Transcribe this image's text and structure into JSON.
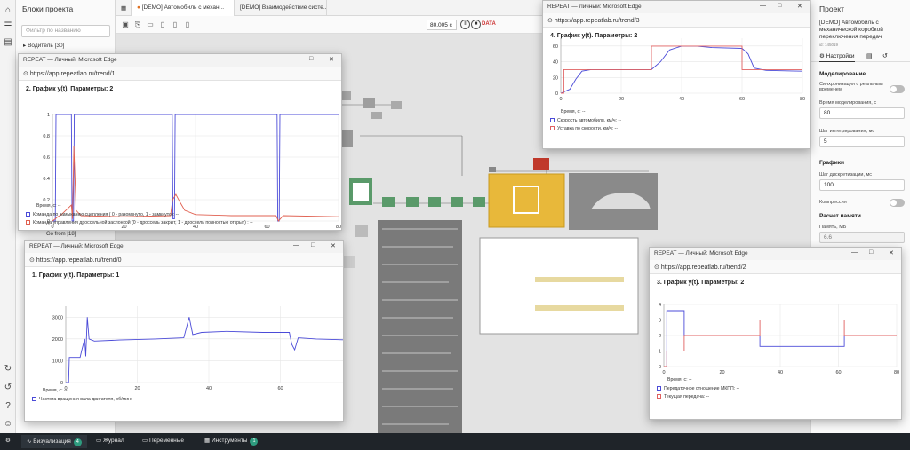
{
  "left_panel": {
    "title": "Блоки проекта",
    "search_placeholder": "Фильтр по названию",
    "group_label": "Водитель [30]",
    "goto_label": "Go from [18]"
  },
  "tabs": [
    {
      "label": "[DEMO] Автомобиль с механ..."
    },
    {
      "label": "[DEMO] Взаимодействие систе..."
    }
  ],
  "toolbar": {
    "sim_time": "80.005 с",
    "data_tag": "DATA"
  },
  "right_panel": {
    "header": "Проект",
    "project_name": "[DEMO] Автомобиль с механической коробкой переключения передач",
    "project_id": "id: 145019",
    "tab_settings": "Настройки",
    "section_modeling": "Моделирование",
    "sync_label": "Синхронизация с реальным временем",
    "model_time_label": "Время моделирования, с",
    "model_time_value": "80",
    "step_label": "Шаг интегрирования, мс",
    "step_value": "5",
    "section_graphs": "Графики",
    "discrete_label": "Шаг дискретизации, мс",
    "discrete_value": "100",
    "compression_label": "Компрессия",
    "section_memory": "Расчет памяти",
    "memory_label": "Память, МБ",
    "memory_value": "6.6"
  },
  "bottom_bar": {
    "visualization": "Визуализация",
    "visualization_badge": "4",
    "journal": "Журнал",
    "variables": "Переменные",
    "tools": "Инструменты",
    "tools_badge": "1"
  },
  "windows": [
    {
      "title": "REPEAT — Личный: Microsoft Edge",
      "url": "https://app.repeatlab.ru/trend/1",
      "graph_title": "2. График y(t). Параметры: 2",
      "time_label": "Время, с: --",
      "legend": [
        "Команда по замыканию сцепления ( 0 - разомкнуто, 1 - замкнуто): --",
        "Команда управления дроссельной заслонкой (0 - дроссель закрыт, 1 - дроссель полностью открыт) : --"
      ],
      "chart_data": {
        "type": "line",
        "xlim": [
          0,
          80
        ],
        "ylim": [
          0,
          1
        ],
        "xticks": [
          0,
          20,
          40,
          60,
          80
        ],
        "yticks": [
          0,
          0.2,
          0.4,
          0.6,
          0.8,
          1
        ],
        "series": [
          {
            "name": "Команда по замыканию сцепления ( 0 - разомкнуто, 1 - замкнуто)",
            "color": "#4b4bd8",
            "points": [
              [
                0,
                0
              ],
              [
                0.8,
                0
              ],
              [
                1,
                1
              ],
              [
                5.3,
                1
              ],
              [
                5.5,
                0
              ],
              [
                5.9,
                0
              ],
              [
                6.1,
                1
              ],
              [
                33.5,
                1
              ],
              [
                33.7,
                0.02
              ],
              [
                34.1,
                0.02
              ],
              [
                34.3,
                1
              ],
              [
                62.8,
                1
              ],
              [
                63,
                0
              ],
              [
                63.4,
                0
              ],
              [
                63.6,
                1
              ],
              [
                80,
                1
              ]
            ]
          },
          {
            "name": "Команда управления дроссельной заслонкой (0 - дроссель закрыт, 1 - дроссель полностью открыт)",
            "color": "#e06050",
            "points": [
              [
                0,
                0
              ],
              [
                0.8,
                0.02
              ],
              [
                1.5,
                0.04
              ],
              [
                2.5,
                0.06
              ],
              [
                5.3,
                0.15
              ],
              [
                5.6,
                0.02
              ],
              [
                6,
                0.7
              ],
              [
                6.6,
                0.1
              ],
              [
                8,
                0.05
              ],
              [
                20,
                0.04
              ],
              [
                33,
                0.05
              ],
              [
                33.6,
                0.2
              ],
              [
                34.5,
                0.25
              ],
              [
                35.6,
                0.18
              ],
              [
                37,
                0.1
              ],
              [
                40,
                0.06
              ],
              [
                50,
                0.05
              ],
              [
                62.5,
                0.05
              ],
              [
                63.2,
                0
              ],
              [
                64.5,
                0.05
              ],
              [
                80,
                0.04
              ]
            ]
          }
        ]
      }
    },
    {
      "title": "REPEAT — Личный: Microsoft Edge",
      "url": "https://app.repeatlab.ru/trend/0",
      "graph_title": "1. График y(t). Параметры: 1",
      "time_label": "Время, с: --",
      "legend": [
        "Частота вращения вала двигателя, об/мин: --"
      ],
      "chart_data": {
        "type": "line",
        "xlim": [
          0,
          80
        ],
        "ylim": [
          0,
          3500
        ],
        "xticks": [
          0,
          20,
          40,
          60,
          80
        ],
        "yticks": [
          0,
          1000,
          2000,
          3000
        ],
        "series": [
          {
            "name": "Частота вращения вала двигателя, об/мин",
            "color": "#4b4bd8",
            "points": [
              [
                0,
                0
              ],
              [
                0.8,
                0
              ],
              [
                1,
                1150
              ],
              [
                4,
                1150
              ],
              [
                4.5,
                1500
              ],
              [
                5.3,
                2000
              ],
              [
                5.6,
                1200
              ],
              [
                6,
                3000
              ],
              [
                6.5,
                2000
              ],
              [
                8,
                1900
              ],
              [
                15,
                1950
              ],
              [
                25,
                2000
              ],
              [
                33,
                2050
              ],
              [
                34.5,
                3000
              ],
              [
                35.5,
                2200
              ],
              [
                38,
                2300
              ],
              [
                45,
                2350
              ],
              [
                55,
                2300
              ],
              [
                62.5,
                2300
              ],
              [
                63.2,
                1750
              ],
              [
                64,
                1500
              ],
              [
                65,
                2050
              ],
              [
                70,
                2000
              ],
              [
                80,
                1950
              ]
            ]
          }
        ]
      }
    },
    {
      "title": "REPEAT — Личный: Microsoft Edge",
      "url": "https://app.repeatlab.ru/trend/3",
      "graph_title": "4. График y(t). Параметры: 2",
      "time_label": "Время, с: --",
      "legend": [
        "Скорость автомобиля, км/ч: --",
        "Уставка по скорости, км/ч: --"
      ],
      "chart_data": {
        "type": "line",
        "xlim": [
          0,
          80
        ],
        "ylim": [
          0,
          70
        ],
        "xticks": [
          0,
          20,
          40,
          60,
          80
        ],
        "yticks": [
          0,
          20,
          40,
          60
        ],
        "series": [
          {
            "name": "Скорость автомобиля, км/ч",
            "color": "#4b4bd8",
            "points": [
              [
                0,
                0
              ],
              [
                3,
                5
              ],
              [
                5,
                18
              ],
              [
                7,
                28
              ],
              [
                10,
                30
              ],
              [
                30,
                30
              ],
              [
                33,
                40
              ],
              [
                36,
                55
              ],
              [
                40,
                60
              ],
              [
                45,
                60
              ],
              [
                50,
                58
              ],
              [
                60,
                57
              ],
              [
                62,
                50
              ],
              [
                64,
                32
              ],
              [
                68,
                29
              ],
              [
                80,
                28
              ]
            ]
          },
          {
            "name": "Уставка по скорости, км/ч",
            "color": "#e06060",
            "points": [
              [
                0,
                0
              ],
              [
                1,
                0
              ],
              [
                1,
                30
              ],
              [
                30,
                30
              ],
              [
                30,
                60
              ],
              [
                60,
                60
              ],
              [
                60,
                30
              ],
              [
                80,
                30
              ]
            ]
          }
        ]
      }
    },
    {
      "title": "REPEAT — Личный: Microsoft Edge",
      "url": "https://app.repeatlab.ru/trend/2",
      "graph_title": "3. График y(t). Параметры: 2",
      "time_label": "Время, с: --",
      "legend": [
        "Передаточное отношение МКПП: --",
        "Текущая передача: --"
      ],
      "chart_data": {
        "type": "line",
        "xlim": [
          0,
          80
        ],
        "ylim": [
          0,
          4
        ],
        "xticks": [
          0,
          20,
          40,
          60,
          80
        ],
        "yticks": [
          0,
          1,
          2,
          3,
          4
        ],
        "series": [
          {
            "name": "Передаточное отношение МКПП",
            "color": "#4b4bd8",
            "points": [
              [
                0,
                0
              ],
              [
                1,
                0
              ],
              [
                1,
                3.6
              ],
              [
                7,
                3.6
              ],
              [
                7,
                2
              ],
              [
                33,
                2
              ],
              [
                33,
                1.3
              ],
              [
                62,
                1.3
              ],
              [
                62,
                2
              ],
              [
                80,
                2
              ]
            ]
          },
          {
            "name": "Текущая передача",
            "color": "#e06060",
            "points": [
              [
                0,
                0
              ],
              [
                1,
                0
              ],
              [
                1,
                1
              ],
              [
                7,
                1
              ],
              [
                7,
                2
              ],
              [
                33,
                2
              ],
              [
                33,
                3
              ],
              [
                62,
                3
              ],
              [
                62,
                2
              ],
              [
                80,
                2
              ]
            ]
          }
        ]
      }
    }
  ]
}
